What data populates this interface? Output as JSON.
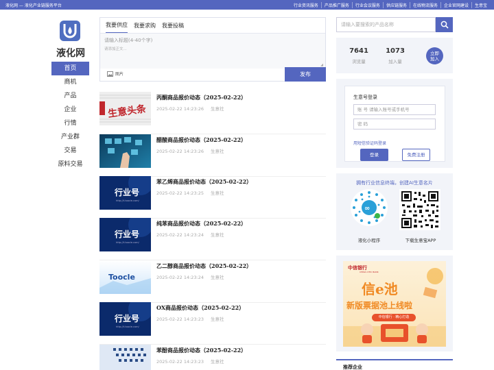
{
  "topbar": {
    "site_title": "液化网 — 液化产业链服务平台",
    "links": [
      "行业资讯服务",
      "产品推广服务",
      "行业会议服务",
      "供应链服务",
      "在线物流服务",
      "企业官网建设",
      "生意宝"
    ]
  },
  "brand": {
    "name": "液化网"
  },
  "nav": {
    "items": [
      "首页",
      "商机",
      "产品",
      "企业",
      "行情",
      "产业群",
      "交易",
      "原料交易"
    ],
    "active_index": 0
  },
  "post": {
    "tabs": [
      "我要供应",
      "我要求购",
      "我要投稿"
    ],
    "active_tab": 0,
    "title_placeholder": "请输入标题(4-40个字)",
    "content_placeholder": "请添加正文...",
    "image_label": "图片",
    "publish_label": "发布"
  },
  "news": [
    {
      "title": "丙酮商品报价动态（2025-02-22）",
      "time": "2025-02-22 14:23:26",
      "source": "生意社",
      "thumb": "newspaper"
    },
    {
      "title": "醋酸商品报价动态（2025-02-22）",
      "time": "2025-02-22 14:23:26",
      "source": "生意社",
      "thumb": "tech"
    },
    {
      "title": "苯乙烯商品报价动态（2025-02-22）",
      "time": "2025-02-22 14:23:25",
      "source": "生意社",
      "thumb": "hangye"
    },
    {
      "title": "纯苯商品报价动态（2025-02-22）",
      "time": "2025-02-22 14:23:24",
      "source": "生意社",
      "thumb": "hangye"
    },
    {
      "title": "乙二醇商品报价动态（2025-02-22）",
      "time": "2025-02-22 14:23:24",
      "source": "生意社",
      "thumb": "toocle"
    },
    {
      "title": "OX商品报价动态（2025-02-22）",
      "time": "2025-02-22 14:23:23",
      "source": "生意社",
      "thumb": "hangye"
    },
    {
      "title": "苯酚商品报价动态（2025-02-22）",
      "time": "2025-02-22 14:23:23",
      "source": "生意社",
      "thumb": "tech2"
    }
  ],
  "thumb_text": {
    "newspaper": "生意头条",
    "hangye": "行业号",
    "hangye_url": "http://t.toocle.com/",
    "toocle": "Toocle"
  },
  "search": {
    "placeholder": "请输入要搜索的产品名称"
  },
  "stats": {
    "views": "7641",
    "views_label": "浏览量",
    "joined": "1073",
    "joined_label": "加入量",
    "join_label_1": "立即",
    "join_label_2": "加入"
  },
  "login": {
    "heading": "生意号登录",
    "account_placeholder": "账 号  请输入账号或手机号",
    "password_placeholder": "密 码",
    "sms_link": "用短信验证码登录",
    "login_button": "登录",
    "register_button": "免费注册"
  },
  "apps": {
    "heading": "拥有行业信息终端，创建AI生意名片",
    "mini_label": "液化小程序",
    "app_label": "下载生意宝APP"
  },
  "ad": {
    "bank": "中信银行",
    "bank_en": "CHINA CITIC BANK",
    "headline": "信e池",
    "subline": "新版票据池上线啦",
    "tag": "中信银行 · 精心打造"
  },
  "recommend": {
    "heading": "推荐企业"
  },
  "colors": {
    "brand": "#5466bf",
    "panel": "#f2f4f9",
    "ad_orange": "#f08a24",
    "ad_red": "#c0272d"
  }
}
